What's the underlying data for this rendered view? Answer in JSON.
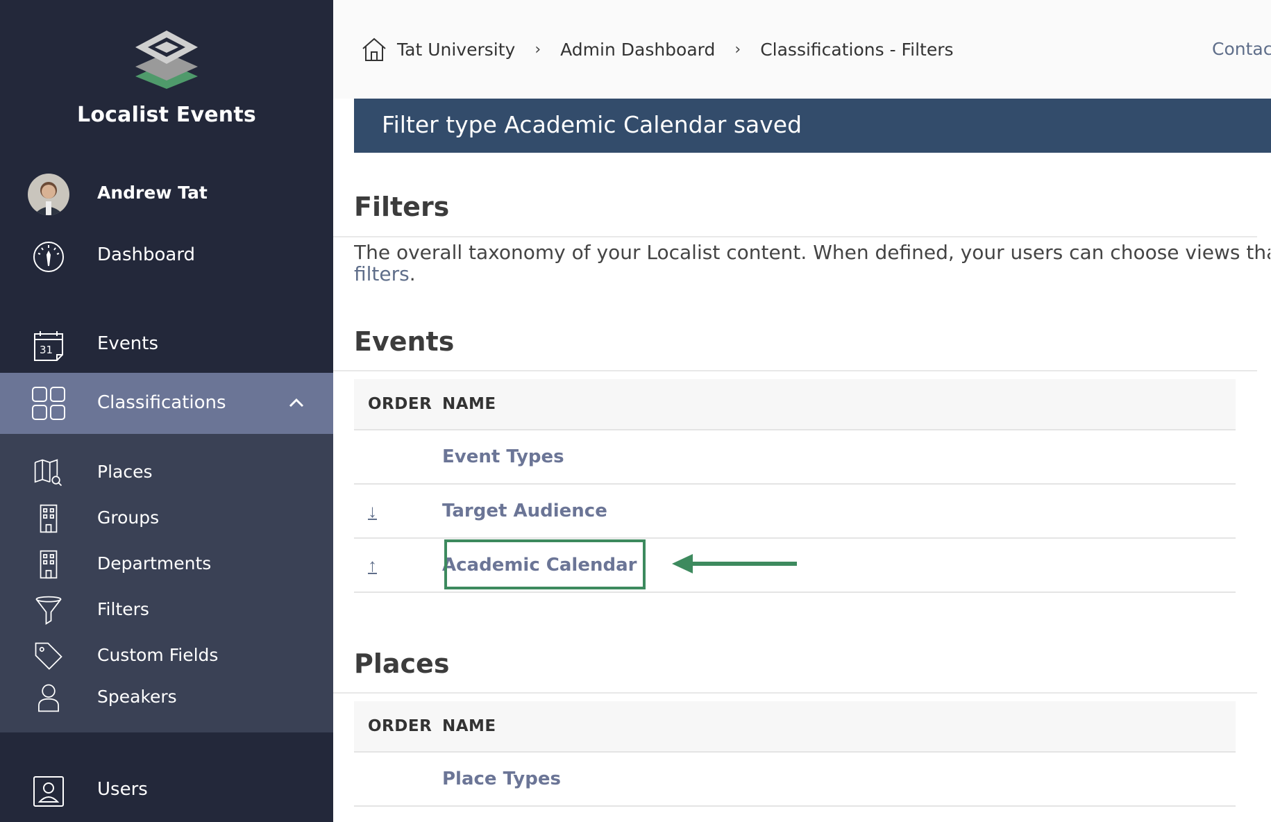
{
  "sidebar": {
    "brand": "Localist Events",
    "user_name": "Andrew Tat",
    "items": [
      {
        "label": "Dashboard",
        "icon": "dashboard-gauge-icon"
      },
      {
        "label": "Events",
        "icon": "calendar-icon"
      },
      {
        "label": "Classifications",
        "icon": "grid-icon",
        "active": true
      },
      {
        "label": "Users",
        "icon": "user-badge-icon"
      }
    ],
    "sub_items": [
      {
        "label": "Places",
        "icon": "map-search-icon"
      },
      {
        "label": "Groups",
        "icon": "building-icon"
      },
      {
        "label": "Departments",
        "icon": "building-icon"
      },
      {
        "label": "Filters",
        "icon": "funnel-icon"
      },
      {
        "label": "Custom Fields",
        "icon": "tag-icon"
      },
      {
        "label": "Speakers",
        "icon": "person-icon"
      }
    ]
  },
  "header": {
    "breadcrumbs": [
      "Tat University",
      "Admin Dashboard",
      "Classifications - Filters"
    ],
    "separator": "›",
    "contact": "Contact"
  },
  "flash": "Filter type Academic Calendar saved",
  "page": {
    "title": "Filters",
    "description": "The overall taxonomy of your Localist content. When defined, your users can choose views that c",
    "description_link": "filters",
    "description_end": "."
  },
  "events_section": {
    "title": "Events",
    "col_order": "ORDER",
    "col_name": "NAME",
    "rows": [
      {
        "order": "",
        "name": "Event Types"
      },
      {
        "order": "↓",
        "name": "Target Audience"
      },
      {
        "order": "↑",
        "name": "Academic Calendar"
      }
    ]
  },
  "places_section": {
    "title": "Places",
    "col_order": "ORDER",
    "col_name": "NAME",
    "rows": [
      {
        "order": "",
        "name": "Place Types"
      }
    ]
  },
  "colors": {
    "sidebar_bg": "#23283a",
    "active_bg": "#6b7596",
    "flash_bg": "#334c6b",
    "highlight": "#3d8a5e"
  }
}
